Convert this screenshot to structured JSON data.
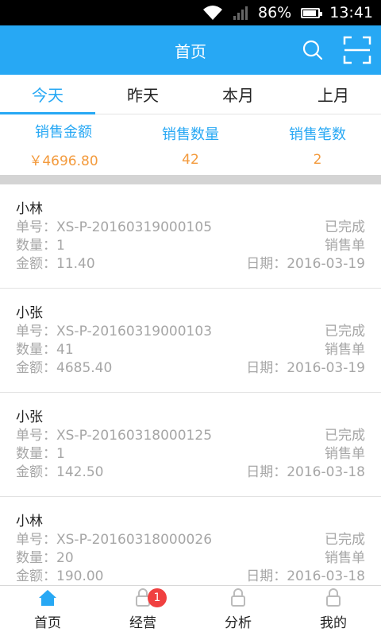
{
  "status_bar": {
    "battery": "86%",
    "time": "13:41",
    "battery_level": 0.86
  },
  "header": {
    "title": "首页",
    "search_icon": "search-icon",
    "scan_icon": "scan-icon"
  },
  "tabs": [
    {
      "label": "今天",
      "active": true
    },
    {
      "label": "昨天",
      "active": false
    },
    {
      "label": "本月",
      "active": false
    },
    {
      "label": "上月",
      "active": false
    }
  ],
  "summary": [
    {
      "label": "销售金额",
      "value": "￥4696.80"
    },
    {
      "label": "销售数量",
      "value": "42"
    },
    {
      "label": "销售笔数",
      "value": "2"
    }
  ],
  "orders": [
    {
      "name": "小林",
      "order_no": "单号：XS-P-20160319000105",
      "status": "已完成",
      "qty": "数量：1",
      "type": "销售单",
      "amount": "金额：11.40",
      "date": "日期：2016-03-19"
    },
    {
      "name": "小张",
      "order_no": "单号：XS-P-20160319000103",
      "status": "已完成",
      "qty": "数量：41",
      "type": "销售单",
      "amount": "金额：4685.40",
      "date": "日期：2016-03-19"
    },
    {
      "name": "小张",
      "order_no": "单号：XS-P-20160318000125",
      "status": "已完成",
      "qty": "数量：1",
      "type": "销售单",
      "amount": "金额：142.50",
      "date": "日期：2016-03-18"
    },
    {
      "name": "小林",
      "order_no": "单号：XS-P-20160318000026",
      "status": "已完成",
      "qty": "数量：20",
      "type": "销售单",
      "amount": "金额：190.00",
      "date": "日期：2016-03-18"
    }
  ],
  "bottom_nav": [
    {
      "label": "首页",
      "icon": "home-icon",
      "active": true
    },
    {
      "label": "经营",
      "icon": "lock-icon",
      "badge": "1"
    },
    {
      "label": "分析",
      "icon": "lock-icon"
    },
    {
      "label": "我的",
      "icon": "lock-icon"
    }
  ],
  "colors": {
    "primary": "#27a8f4",
    "accent": "#f39a3c",
    "badge": "#f04040"
  }
}
